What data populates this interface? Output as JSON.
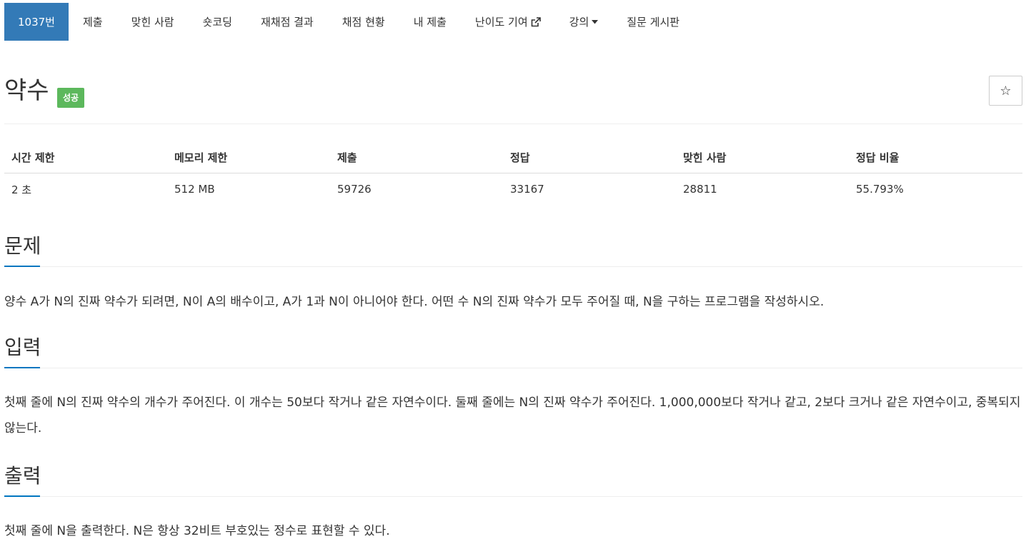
{
  "nav": {
    "items": [
      {
        "label": "1037번",
        "active": true
      },
      {
        "label": "제출"
      },
      {
        "label": "맞힌 사람"
      },
      {
        "label": "숏코딩"
      },
      {
        "label": "재채점 결과"
      },
      {
        "label": "채점 현황"
      },
      {
        "label": "내 제출"
      },
      {
        "label": "난이도 기여",
        "icon": "external-link-icon"
      },
      {
        "label": "강의",
        "icon": "caret-down-icon"
      },
      {
        "label": "질문 게시판"
      }
    ]
  },
  "problem": {
    "title": "약수",
    "status": "성공",
    "star_icon": "star-icon",
    "star_label": "☆"
  },
  "info": {
    "headers": [
      "시간 제한",
      "메모리 제한",
      "제출",
      "정답",
      "맞힌 사람",
      "정답 비율"
    ],
    "values": [
      "2 초",
      "512 MB",
      "59726",
      "33167",
      "28811",
      "55.793%"
    ]
  },
  "sections": {
    "problem": {
      "heading": "문제",
      "text": "양수 A가 N의 진짜 약수가 되려면, N이 A의 배수이고, A가 1과 N이 아니어야 한다. 어떤 수 N의 진짜 약수가 모두 주어질 때, N을 구하는 프로그램을 작성하시오."
    },
    "input": {
      "heading": "입력",
      "text": "첫째 줄에 N의 진짜 약수의 개수가 주어진다. 이 개수는 50보다 작거나 같은 자연수이다. 둘째 줄에는 N의 진짜 약수가 주어진다. 1,000,000보다 작거나 같고, 2보다 크거나 같은 자연수이고, 중복되지 않는다."
    },
    "output": {
      "heading": "출력",
      "text": "첫째 줄에 N을 출력한다. N은 항상 32비트 부호있는 정수로 표현할 수 있다."
    }
  },
  "colors": {
    "active_tab": "#337ab7",
    "success_badge": "#5cb85c",
    "section_accent": "#0076c0"
  }
}
